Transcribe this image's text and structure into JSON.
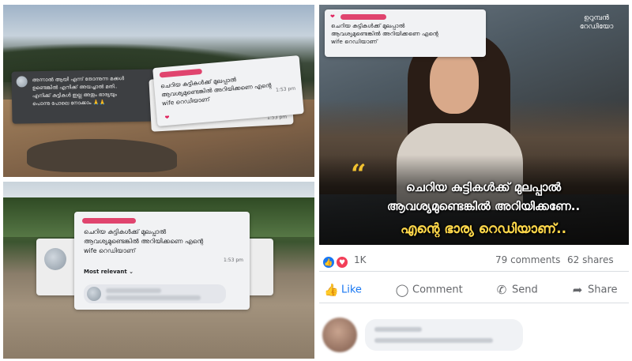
{
  "cards": {
    "left_dark": {
      "text_lines": [
        "അന്നാൽ ആയി എന്ന് തോന്നുന്ന മക്കൾ",
        "ഉണ്ടെങ്കിൽ എനിക്ക് അയച്ചാൽ മതി..",
        "എനിക്ക് കുട്ടികൾ ഇല്ല അതും ഭാര്യയും",
        "പൊന്നു പോലെ നോക്കാം 🙏🙏"
      ]
    },
    "top": {
      "text_lines": [
        "ചെറിയ കുട്ടികൾക്ക് മുലപ്പാൽ",
        "ആവശ്യമുണ്ടെങ്കിൽ അറിയിക്കണെ എന്റെ",
        "wife റെഡിയാണ്"
      ],
      "time": "1:53 pm"
    },
    "top_behind": {
      "time": "1:53 pm"
    },
    "right_top": {
      "text_lines": [
        "ചെറിയ കുട്ടികൾക്ക് മുലപ്പാൽ",
        "ആവശ്യമുണ്ടെങ്കിൽ അറിയിക്കണെ എന്റെ",
        "wife റെഡിയാണ്"
      ]
    },
    "bottom": {
      "text_lines": [
        "ചെറിയ കുട്ടികൾക്ക് മുലപ്പാൽ",
        "ആവശ്യമുണ്ടെങ്കിൽ അറിയിക്കണെ എന്റെ",
        "wife റെഡിയാണ്"
      ],
      "time": "1:53 pm",
      "sort_label": "Most relevant ⌄"
    }
  },
  "poster": {
    "logo": "ഉറുമ്പൻ റേഡിയോ",
    "quote": "“",
    "caption_line1": "ചെറിയ കുട്ടികൾക്ക് മുലപ്പാൽ",
    "caption_line2": "ആവശ്യമുണ്ടെങ്കിൽ അറിയിക്കണേ..",
    "caption_line3": "എന്റെ ഭാര്യ റെഡിയാണ്.."
  },
  "facebook": {
    "reaction_count": "1K",
    "comments": "79 comments",
    "shares": "62 shares",
    "actions": {
      "like": "Like",
      "comment": "Comment",
      "send": "Send",
      "share": "Share"
    }
  },
  "colors": {
    "facebook_blue": "#1877f2",
    "highlight_yellow": "#ffd84a",
    "redaction_pink": "#e0446e"
  }
}
